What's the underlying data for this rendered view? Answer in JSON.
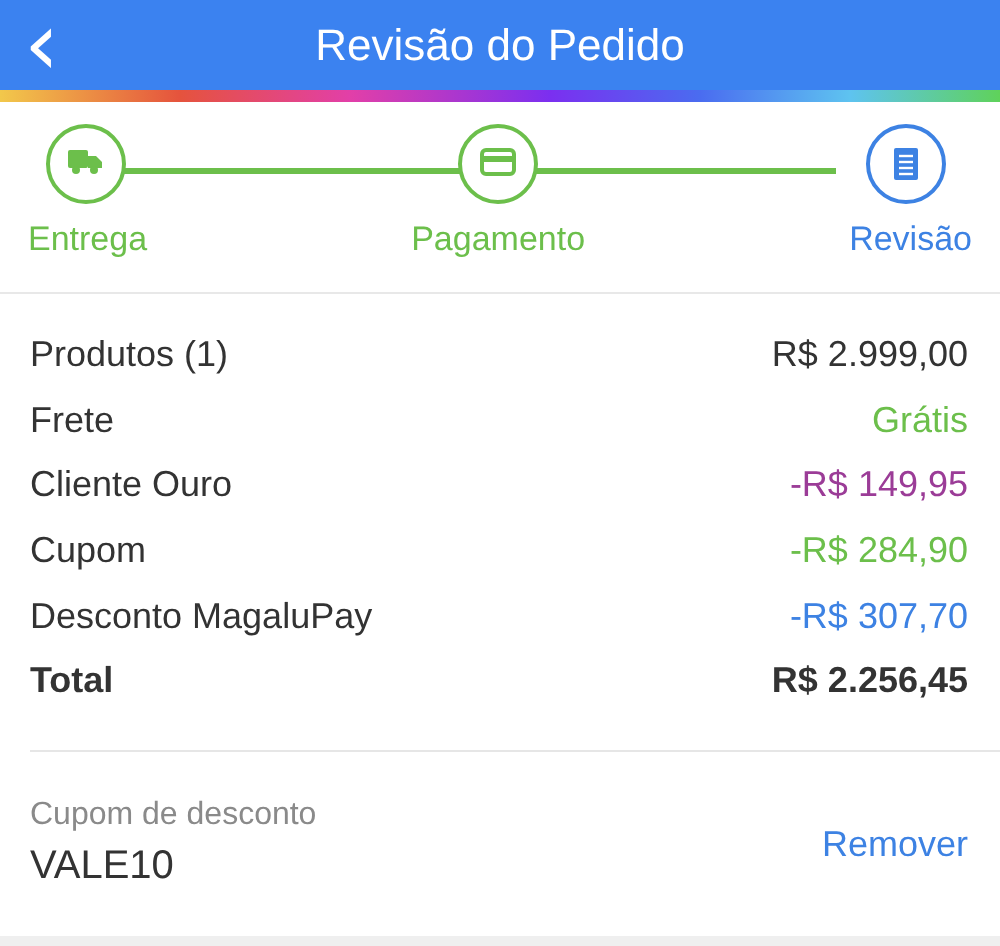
{
  "header": {
    "back_icon": "‹",
    "title": "Revisão do Pedido"
  },
  "steps": [
    {
      "label": "Entrega",
      "kind": "truck",
      "selected": false
    },
    {
      "label": "Pagamento",
      "kind": "card",
      "selected": false
    },
    {
      "label": "Revisão",
      "kind": "receipt",
      "selected": true
    }
  ],
  "summary": [
    {
      "label": "Produtos (1)",
      "value": "R$ 2.999,00",
      "kind": "line",
      "color": "#333333"
    },
    {
      "label": "Frete",
      "value": "Grátis",
      "kind": "line",
      "color": "#6cbf4b"
    },
    {
      "label": "Cliente Ouro",
      "value": "-R$ 149,95",
      "kind": "line",
      "color": "#9b3c97"
    },
    {
      "label": "Cupom",
      "value": "-R$ 284,90",
      "kind": "line",
      "color": "#6cbf4b"
    },
    {
      "label": "Desconto MagaluPay",
      "value": "-R$ 307,70",
      "kind": "line",
      "color": "#3d82e3"
    },
    {
      "label": "Total",
      "value": "R$ 2.256,45",
      "kind": "total",
      "color": "#333333"
    }
  ],
  "coupon": {
    "caption": "Cupom de desconto",
    "code": "VALE10",
    "action": "Remover"
  }
}
